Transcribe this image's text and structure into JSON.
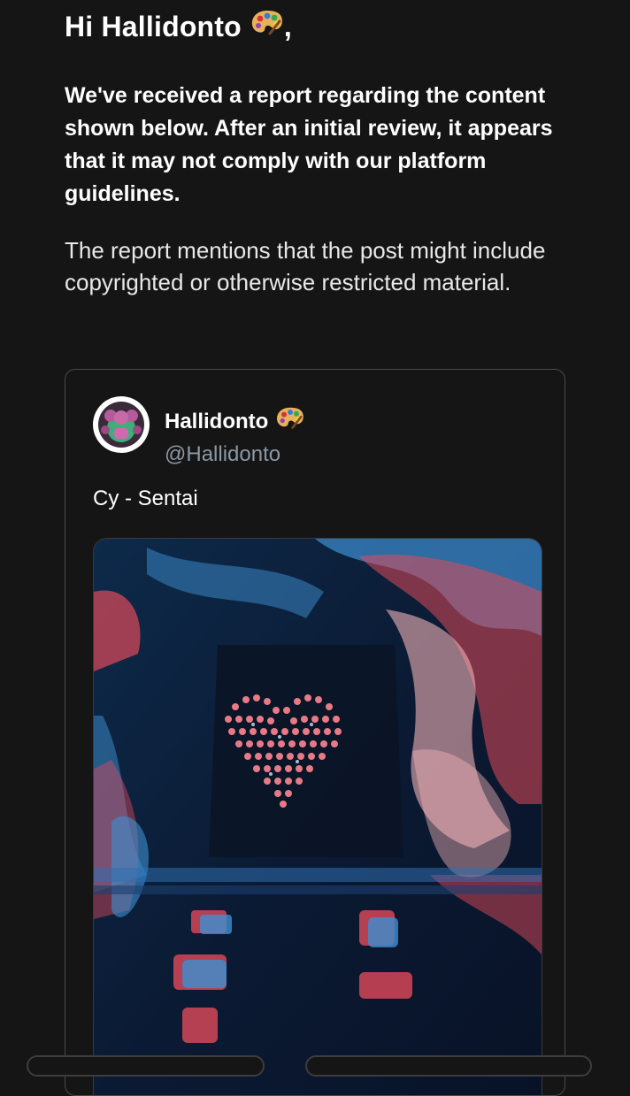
{
  "greeting": {
    "text": "Hi Hallidonto",
    "suffix": ",",
    "emoji_icon": "artist-palette-icon"
  },
  "notice": {
    "bold_text": "We've received a report regarding the content shown below. After an initial review, it appears that it may not comply with our platform guidelines.",
    "body_text": "The report mentions that the post might include copyrighted or otherwise restricted material."
  },
  "post": {
    "display_name": "Hallidonto",
    "display_name_emoji_icon": "artist-palette-icon",
    "handle": "@Hallidonto",
    "text": "Cy - Sentai",
    "media_description_icon": "artwork-image"
  },
  "colors": {
    "background": "#151515",
    "handle_gray": "#8b98a5",
    "card_border": "#4a4a4a",
    "art_navy": "#0b1a33",
    "art_red": "#e04a5a",
    "art_blue": "#3d8fd1"
  }
}
